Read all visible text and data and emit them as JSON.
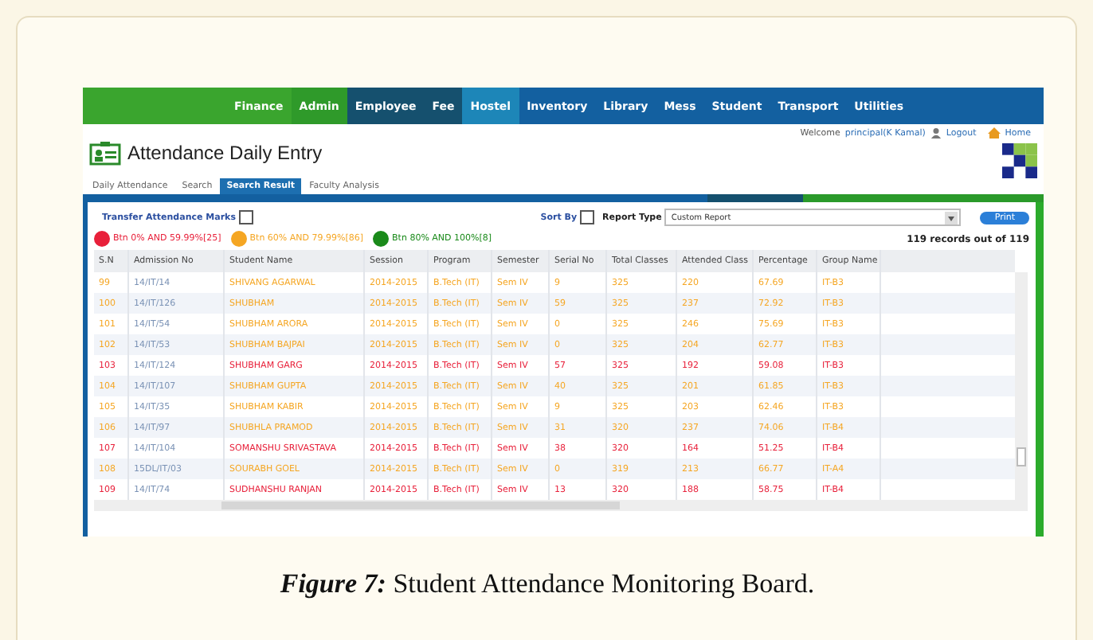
{
  "nav": [
    {
      "label": "Finance",
      "color": "#3aa52e"
    },
    {
      "label": "Admin",
      "color": "#2f9a2a"
    },
    {
      "label": "Employee",
      "color": "#15506e"
    },
    {
      "label": "Fee",
      "color": "#15506e"
    },
    {
      "label": "Hostel",
      "color": "#1d86b8"
    },
    {
      "label": "Inventory",
      "color": "#1360a0"
    },
    {
      "label": "Library",
      "color": "#1360a0"
    },
    {
      "label": "Mess",
      "color": "#1360a0"
    },
    {
      "label": "Student",
      "color": "#1360a0"
    },
    {
      "label": "Transport",
      "color": "#1360a0"
    },
    {
      "label": "Utilities",
      "color": "#1360a0"
    }
  ],
  "welcome": {
    "label": "Welcome",
    "user": "principal(K Kamal)",
    "logout": "Logout",
    "home": "Home"
  },
  "title": "Attendance Daily Entry",
  "tabs": [
    {
      "label": "Daily Attendance",
      "selected": false
    },
    {
      "label": "Search",
      "selected": false
    },
    {
      "label": "Search Result",
      "selected": true
    },
    {
      "label": "Faculty Analysis",
      "selected": false
    }
  ],
  "transfer": {
    "label": "Transfer Attendance Marks",
    "checked": false
  },
  "sort": {
    "label": "Sort By",
    "checked": false
  },
  "report_type": {
    "label": "Report Type",
    "value": "Custom Report"
  },
  "print_button": "Print",
  "legend": [
    {
      "label": "Btn 0% AND 59.99%[25]",
      "color": "#e8203a"
    },
    {
      "label": "Btn 60% AND 79.99%[86]",
      "color": "#f5a623"
    },
    {
      "label": "Btn 80% AND 100%[8]",
      "color": "#1a8a1a"
    }
  ],
  "records": "119 records out of 119",
  "table": {
    "columns": [
      "S.N",
      "Admission No",
      "Student Name",
      "Session",
      "Program",
      "Semester",
      "Serial No",
      "Total Classes",
      "Attended Class",
      "Percentage",
      "Group Name"
    ],
    "rows": [
      {
        "color": "#f5a623",
        "cells": [
          "99",
          "14/IT/14",
          "SHIVANG  AGARWAL",
          "2014-2015",
          "B.Tech (IT)",
          "Sem IV",
          "9",
          "325",
          "220",
          "67.69",
          "IT-B3"
        ]
      },
      {
        "color": "#f5a623",
        "cells": [
          "100",
          "14/IT/126",
          "SHUBHAM",
          "2014-2015",
          "B.Tech (IT)",
          "Sem IV",
          "59",
          "325",
          "237",
          "72.92",
          "IT-B3"
        ]
      },
      {
        "color": "#f5a623",
        "cells": [
          "101",
          "14/IT/54",
          "SHUBHAM  ARORA",
          "2014-2015",
          "B.Tech (IT)",
          "Sem IV",
          "0",
          "325",
          "246",
          "75.69",
          "IT-B3"
        ]
      },
      {
        "color": "#f5a623",
        "cells": [
          "102",
          "14/IT/53",
          "SHUBHAM  BAJPAI",
          "2014-2015",
          "B.Tech (IT)",
          "Sem IV",
          "0",
          "325",
          "204",
          "62.77",
          "IT-B3"
        ]
      },
      {
        "color": "#e8203a",
        "cells": [
          "103",
          "14/IT/124",
          "SHUBHAM  GARG",
          "2014-2015",
          "B.Tech (IT)",
          "Sem IV",
          "57",
          "325",
          "192",
          "59.08",
          "IT-B3"
        ]
      },
      {
        "color": "#f5a623",
        "cells": [
          "104",
          "14/IT/107",
          "SHUBHAM  GUPTA",
          "2014-2015",
          "B.Tech (IT)",
          "Sem IV",
          "40",
          "325",
          "201",
          "61.85",
          "IT-B3"
        ]
      },
      {
        "color": "#f5a623",
        "cells": [
          "105",
          "14/IT/35",
          "SHUBHAM  KABIR",
          "2014-2015",
          "B.Tech (IT)",
          "Sem IV",
          "9",
          "325",
          "203",
          "62.46",
          "IT-B3"
        ]
      },
      {
        "color": "#f5a623",
        "cells": [
          "106",
          "14/IT/97",
          "SHUBHLA  PRAMOD",
          "2014-2015",
          "B.Tech (IT)",
          "Sem IV",
          "31",
          "320",
          "237",
          "74.06",
          "IT-B4"
        ]
      },
      {
        "color": "#e8203a",
        "cells": [
          "107",
          "14/IT/104",
          "SOMANSHU  SRIVASTAVA",
          "2014-2015",
          "B.Tech (IT)",
          "Sem IV",
          "38",
          "320",
          "164",
          "51.25",
          "IT-B4"
        ]
      },
      {
        "color": "#f5a623",
        "cells": [
          "108",
          "15DL/IT/03",
          "SOURABH  GOEL",
          "2014-2015",
          "B.Tech (IT)",
          "Sem IV",
          "0",
          "319",
          "213",
          "66.77",
          "IT-A4"
        ]
      },
      {
        "color": "#e8203a",
        "cells": [
          "109",
          "14/IT/74",
          "SUDHANSHU  RANJAN",
          "2014-2015",
          "B.Tech (IT)",
          "Sem IV",
          "13",
          "320",
          "188",
          "58.75",
          "IT-B4"
        ]
      }
    ]
  },
  "caption": "**Figure 7:** Student Attendance Monitoring Board."
}
